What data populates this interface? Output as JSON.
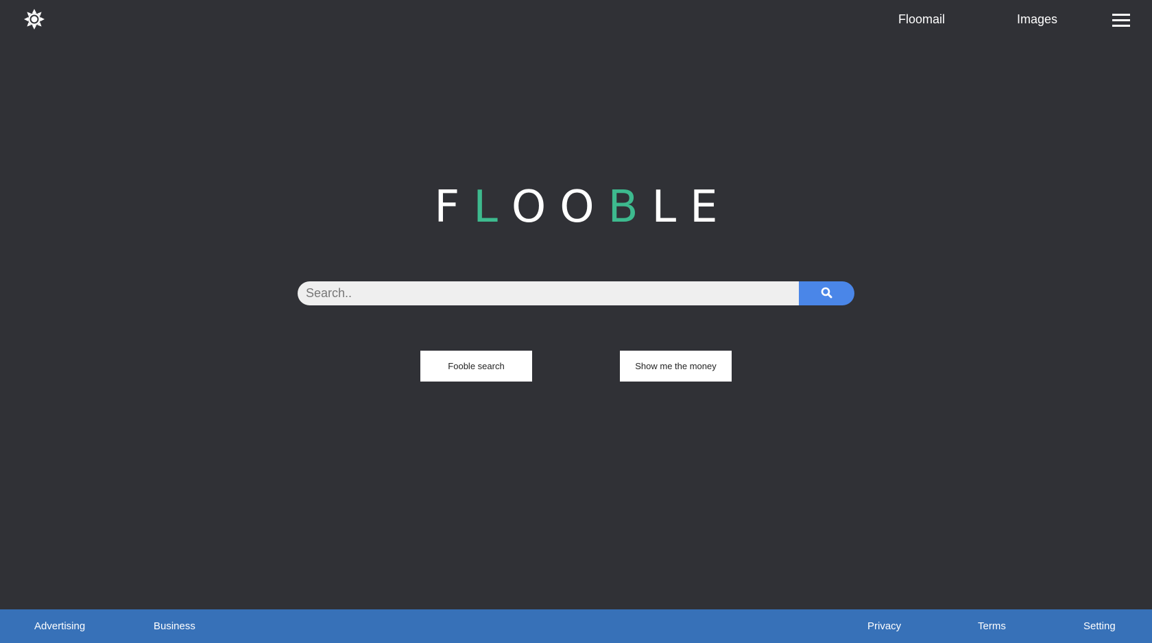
{
  "header": {
    "theme_icon": "sun-gear-icon",
    "links": {
      "floomail": "Floomail",
      "images": "Images"
    },
    "menu_icon": "hamburger-menu-icon"
  },
  "logo": {
    "letters": [
      {
        "char": "F",
        "color": "#ffffff"
      },
      {
        "char": "L",
        "color": "#3dba8e"
      },
      {
        "char": "O",
        "color": "#ffffff"
      },
      {
        "char": "O",
        "color": "#ffffff"
      },
      {
        "char": "B",
        "color": "#3dba8e"
      },
      {
        "char": "L",
        "color": "#ffffff"
      },
      {
        "char": "E",
        "color": "#ffffff"
      }
    ]
  },
  "search": {
    "placeholder": "Search..",
    "value": "",
    "button_icon": "search-icon"
  },
  "actions": {
    "search_label": "Fooble search",
    "money_label": "Show me the money"
  },
  "footer": {
    "advertising": "Advertising",
    "business": "Business",
    "privacy": "Privacy",
    "terms": "Terms",
    "setting": "Setting"
  },
  "colors": {
    "background": "#303136",
    "accent_green": "#3dba8e",
    "search_blue": "#4a86e8",
    "footer_blue": "#3771b8"
  }
}
